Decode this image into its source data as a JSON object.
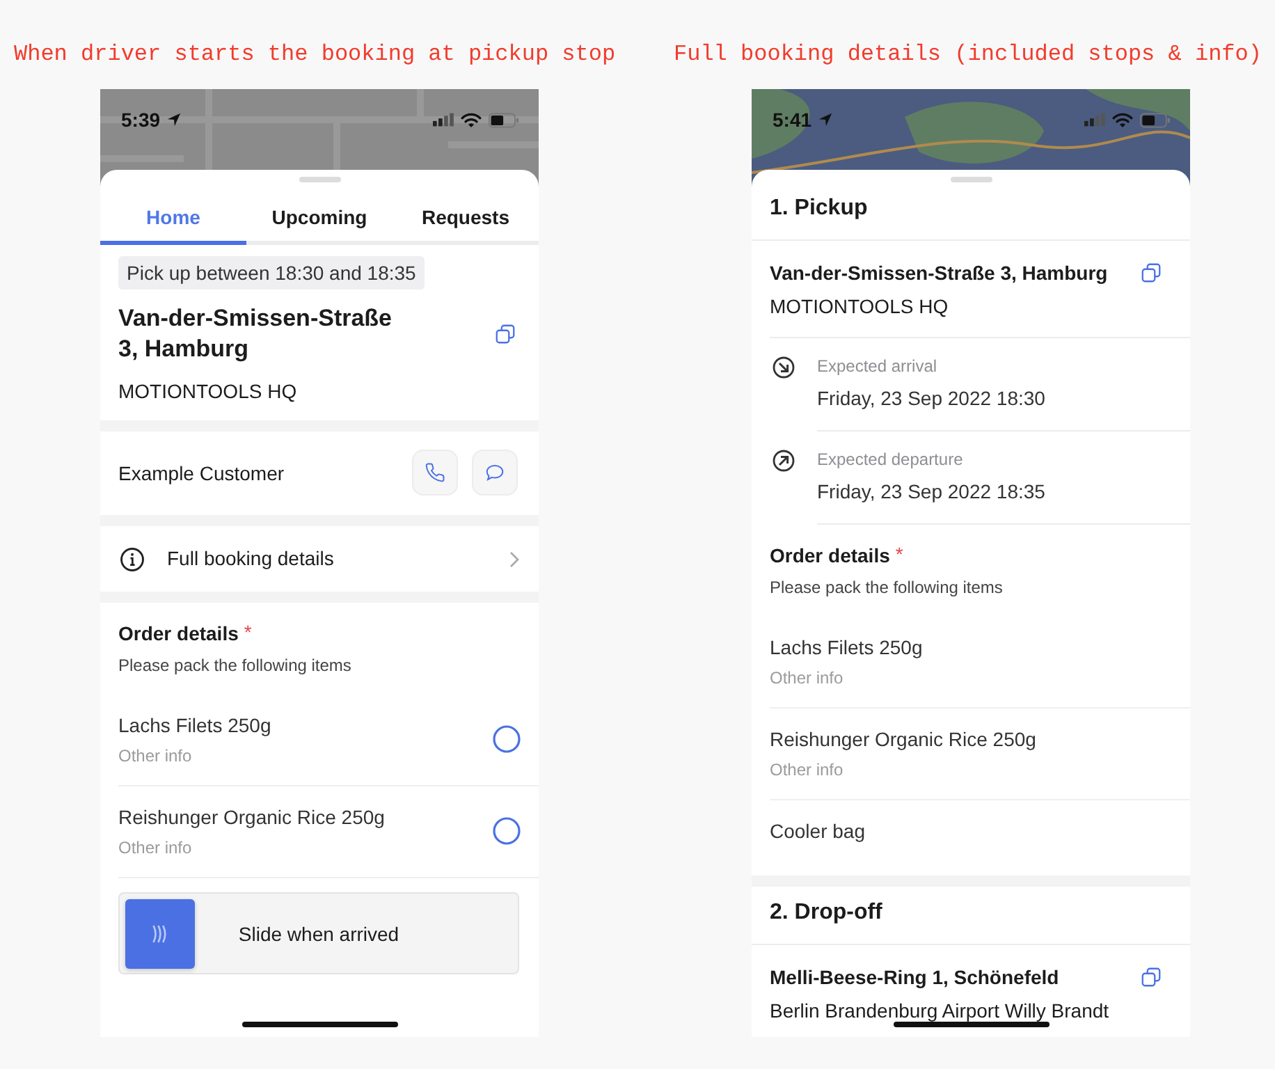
{
  "screens": [
    {
      "kind": "home",
      "caption": "When driver starts the booking at pickup stop",
      "status_bar": {
        "time": "5:39"
      },
      "map": {
        "dimmed": true
      },
      "tabs": [
        {
          "label": "Home",
          "selected": true
        },
        {
          "label": "Upcoming",
          "selected": false
        },
        {
          "label": "Requests",
          "selected": false
        }
      ],
      "pickup": {
        "window": "Pick up between 18:30 and 18:35",
        "address": "Van-der-Smissen-Straße 3, Hamburg",
        "place": "MOTIONTOOLS HQ"
      },
      "customer": {
        "name": "Example Customer"
      },
      "details_link": {
        "label": "Full booking details"
      },
      "order_details": {
        "title": "Order details",
        "required_mark": "*",
        "subtitle": "Please pack the following items",
        "items": [
          {
            "name": "Lachs Filets 250g",
            "info": "Other info",
            "checked": false
          },
          {
            "name": "Reishunger Organic Rice 250g",
            "info": "Other info",
            "checked": false
          }
        ]
      },
      "slider": {
        "label": "Slide when arrived",
        "level": 0
      }
    },
    {
      "kind": "booking_details",
      "caption": "Full booking details (included stops & info)",
      "status_bar": {
        "time": "5:41"
      },
      "map": {
        "dimmed": false
      },
      "stops": [
        {
          "title": "1. Pickup",
          "address": "Van-der-Smissen-Straße 3, Hamburg",
          "place": "MOTIONTOOLS HQ",
          "times": [
            {
              "kind": "arrival",
              "label": "Expected arrival",
              "value": "Friday, 23 Sep 2022 18:30"
            },
            {
              "kind": "departure",
              "label": "Expected departure",
              "value": "Friday, 23 Sep 2022 18:35"
            }
          ],
          "order_details": {
            "title": "Order details",
            "required_mark": "*",
            "subtitle": "Please pack the following items",
            "items": [
              {
                "name": "Lachs Filets 250g",
                "info": "Other info"
              },
              {
                "name": "Reishunger Organic Rice 250g",
                "info": "Other info"
              },
              {
                "name": "Cooler bag"
              }
            ]
          }
        },
        {
          "title": "2. Drop-off",
          "address": "Melli-Beese-Ring 1, Schönefeld",
          "place": "Berlin Brandenburg Airport Willy Brandt"
        }
      ]
    }
  ]
}
